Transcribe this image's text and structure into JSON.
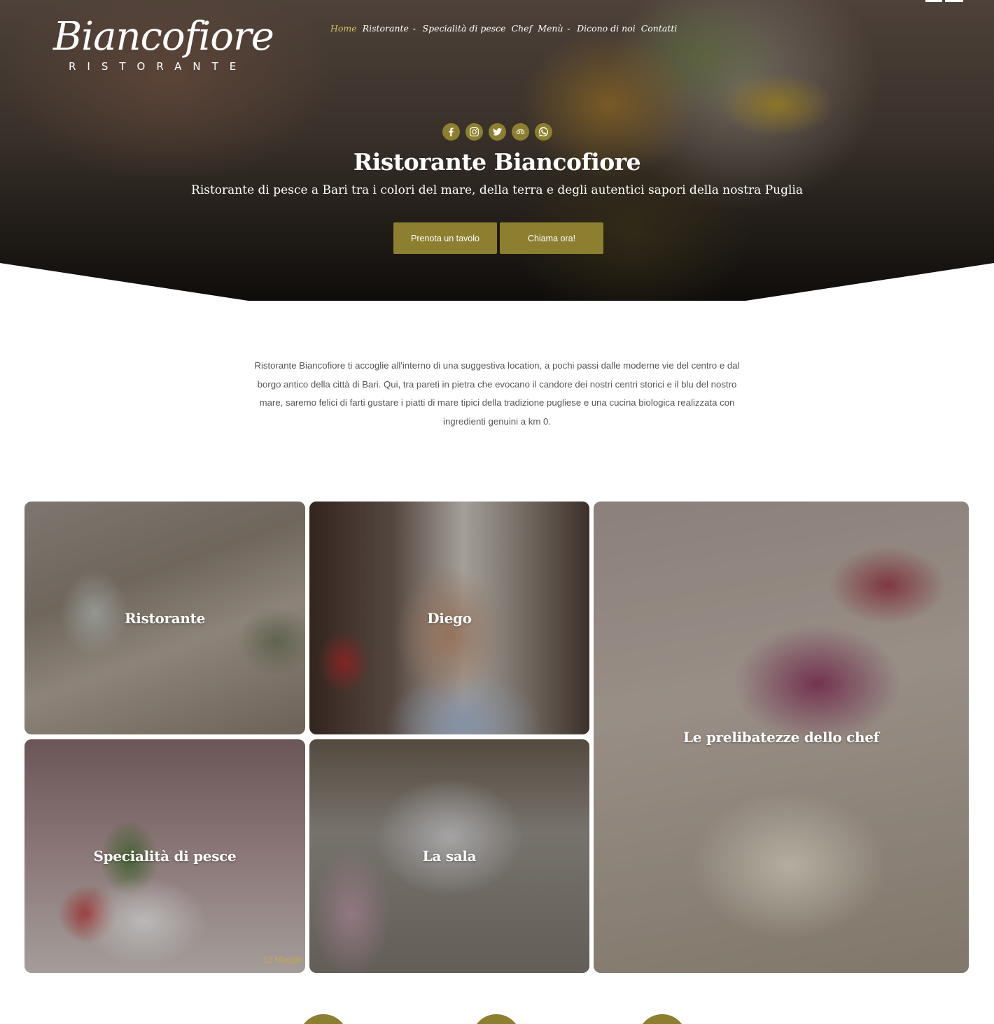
{
  "brand": {
    "logo_main": "Biancofiore",
    "logo_sub": "RISTORANTE"
  },
  "nav": {
    "items": [
      {
        "label": "Home",
        "active": true,
        "dropdown": false
      },
      {
        "label": "Ristorante",
        "active": false,
        "dropdown": true
      },
      {
        "label": "Specialità di pesce",
        "active": false,
        "dropdown": false
      },
      {
        "label": "Chef",
        "active": false,
        "dropdown": false
      },
      {
        "label": "Menù",
        "active": false,
        "dropdown": true
      },
      {
        "label": "Dicono di noi",
        "active": false,
        "dropdown": false
      },
      {
        "label": "Contatti",
        "active": false,
        "dropdown": false
      }
    ]
  },
  "socials": [
    "facebook-icon",
    "instagram-icon",
    "twitter-icon",
    "tripadvisor-icon",
    "whatsapp-icon"
  ],
  "hero": {
    "title": "Ristorante Biancofiore",
    "subtitle": "Ristorante di pesce a Bari  tra i colori del mare, della terra e degli autentici sapori della nostra Puglia",
    "btn_book": "Prenota un tavolo",
    "btn_call": "Chiama ora!"
  },
  "intro": {
    "text": "Ristorante Biancofiore ti accoglie all'interno di una suggestiva location, a pochi passi dalle moderne vie del centro e dal borgo antico della città di Bari. Qui, tra pareti in pietra che evocano il candore dei nostri centri storici e il blu del nostro mare, saremo felici di farti gustare i piatti di mare tipici della tradizione pugliese e una cucina biologica realizzata con ingredienti genuini a km 0."
  },
  "gallery": {
    "ristorante": "Ristorante",
    "diego": "Diego",
    "chef": "Le prelibatezze dello chef",
    "pesce": "Specialità di pesce",
    "sala": "La sala",
    "watermark": "12 Maggio"
  },
  "colors": {
    "accent": "#8c7f2f",
    "nav_active": "#d8c05a"
  }
}
